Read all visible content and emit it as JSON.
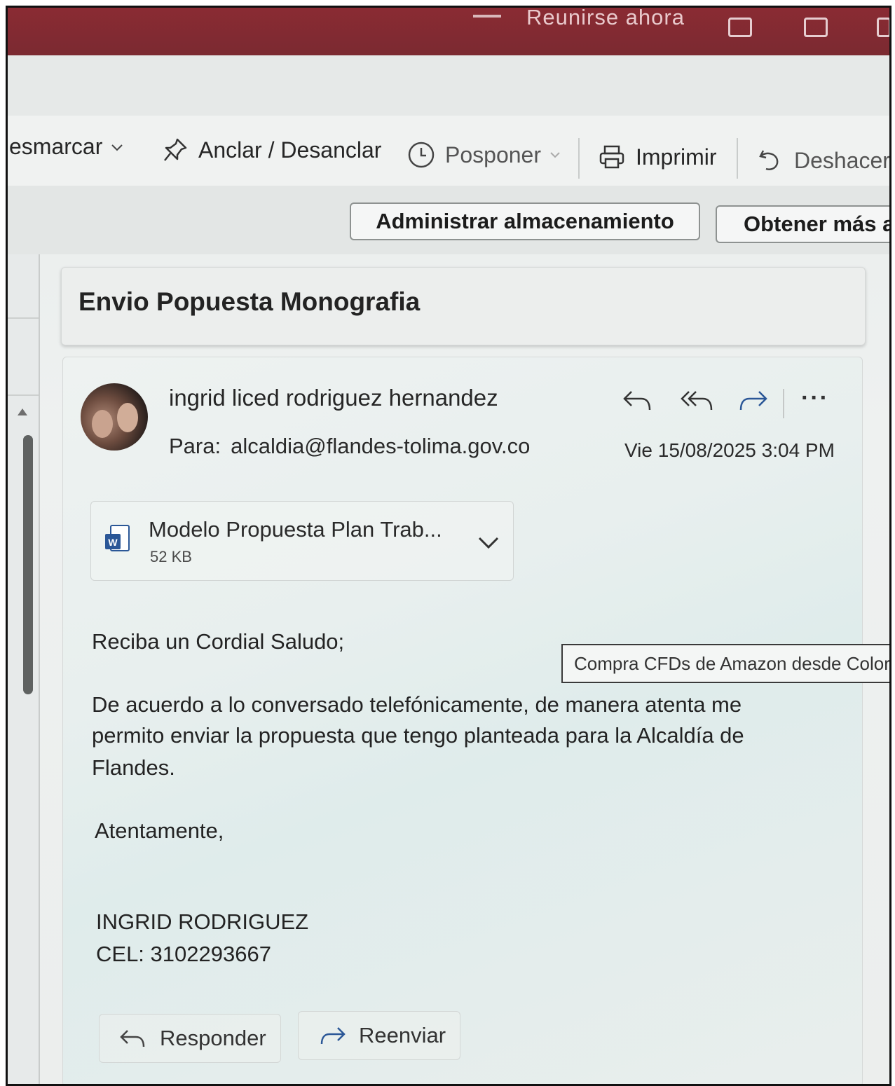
{
  "titlebar": {
    "meet_now": "Reunirse ahora"
  },
  "ribbon": {
    "unmark": "esmarcar",
    "pin": "Anclar / Desanclar",
    "snooze": "Posponer",
    "print": "Imprimir",
    "undo": "Deshacer"
  },
  "banner": {
    "manage_storage": "Administrar almacenamiento",
    "get_more": "Obtener más a"
  },
  "message": {
    "subject": "Envio Popuesta Monografia",
    "sender": "ingrid liced rodriguez hernandez",
    "to_label": "Para:",
    "to_address": "alcaldia@flandes-tolima.gov.co",
    "date": "Vie 15/08/2025 3:04 PM",
    "attachment": {
      "name": "Modelo Propuesta Plan Trab...",
      "size": "52 KB"
    },
    "greeting": "Reciba un Cordial Saludo;",
    "paragraph_line1": "De acuerdo a lo conversado telefónicamente, de manera atenta me",
    "paragraph_line2": "permito enviar la propuesta que tengo planteada para la Alcaldía de",
    "paragraph_line3": "Flandes.",
    "closing": "Atentamente,",
    "signature_name": "INGRID RODRIGUEZ",
    "signature_phone": "CEL: 3102293667"
  },
  "tooltip": "Compra CFDs de Amazon desde Color",
  "footer": {
    "reply": "Responder",
    "forward": "Reenviar"
  },
  "colors": {
    "titlebar": "#7b2a31",
    "accent_blue": "#2b5797"
  }
}
